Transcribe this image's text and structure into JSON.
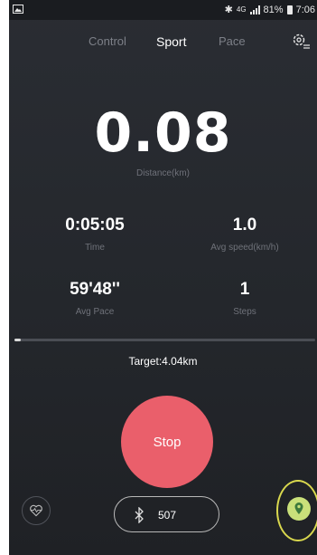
{
  "status_bar": {
    "network": "4G",
    "battery": "81%",
    "time": "7:06"
  },
  "tabs": [
    {
      "label": "Control",
      "active": false
    },
    {
      "label": "Sport",
      "active": true
    },
    {
      "label": "Pace",
      "active": false
    }
  ],
  "distance": {
    "value": "0.08",
    "label": "Distance(km)"
  },
  "stats": {
    "time": {
      "value": "0:05:05",
      "label": "Time"
    },
    "avg_speed": {
      "value": "1.0",
      "label": "Avg speed(km/h)"
    },
    "avg_pace": {
      "value": "59'48''",
      "label": "Avg Pace"
    },
    "steps": {
      "value": "1",
      "label": "Steps"
    }
  },
  "progress": {
    "fraction": 0.02
  },
  "target": {
    "label": "Target:4.04km"
  },
  "controls": {
    "stop_label": "Stop",
    "bluetooth_value": "507"
  },
  "colors": {
    "accent": "#ea5f6b",
    "background": "#2a2d33",
    "map_button": "#c9e07a",
    "highlight": "#d9d84e"
  },
  "icons": [
    "image-icon",
    "bluetooth-icon",
    "signal-icon",
    "battery-icon",
    "settings-icon",
    "heart-rate-icon",
    "map-pin-icon"
  ]
}
